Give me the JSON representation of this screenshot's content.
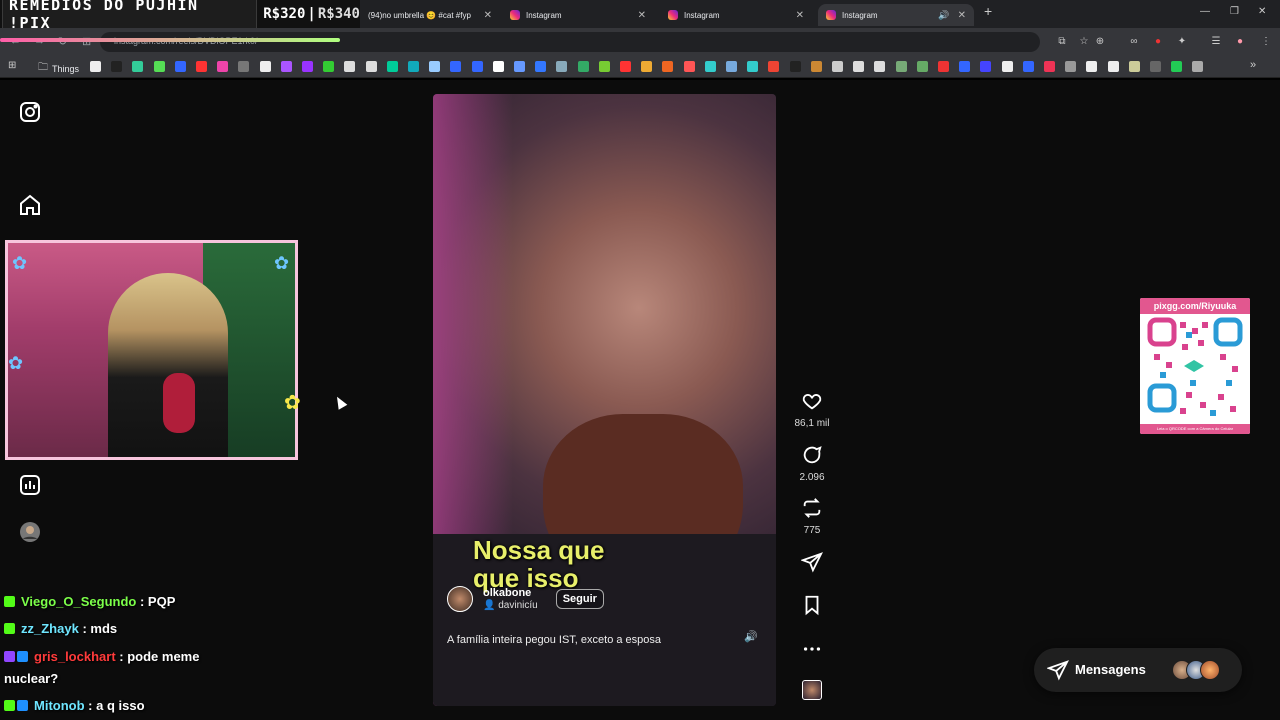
{
  "overlay": {
    "banner_text": "REMÉDIOS DO PUJHIN !PIX",
    "donation_1": "R$320",
    "donation_2": "R$340"
  },
  "tabs": [
    {
      "title": "(94)no umbrella 😊 #cat #fyp"
    },
    {
      "title": "Instagram"
    },
    {
      "title": "Instagram"
    },
    {
      "title": "Instagram"
    }
  ],
  "address": {
    "url": "instagram.com/reels/DVDiOPE1rk0/"
  },
  "bookmarks": {
    "folder_label": "Things"
  },
  "reel": {
    "subtitle_line1": "Nossa que",
    "subtitle_line2": "que isso",
    "username": "olkabone",
    "audio": "davinicíu",
    "follow_label": "Seguir",
    "caption": "A família inteira pegou IST, exceto a esposa"
  },
  "actions": {
    "likes": "86,1 mil",
    "comments": "2.096",
    "reposts": "775"
  },
  "qr": {
    "header": "pixgg.com/Riyuuka",
    "footer": "Leia o QRCODE com a Câmera do Celular"
  },
  "chat": [
    {
      "user": "Viego_O_Segundo",
      "message": ": PQP",
      "color": "#7cff4a"
    },
    {
      "user": "zz_Zhayk",
      "message": ": mds",
      "color": "#6fe6ff"
    },
    {
      "user": "gris_lockhart",
      "message": ": pode meme",
      "color": "#ff3b3b"
    },
    {
      "user": "",
      "message": "nuclear?",
      "color": "#ffffff"
    },
    {
      "user": "Mitonob",
      "message": ": a q isso",
      "color": "#6fe6ff"
    }
  ],
  "messages": {
    "label": "Mensagens"
  }
}
